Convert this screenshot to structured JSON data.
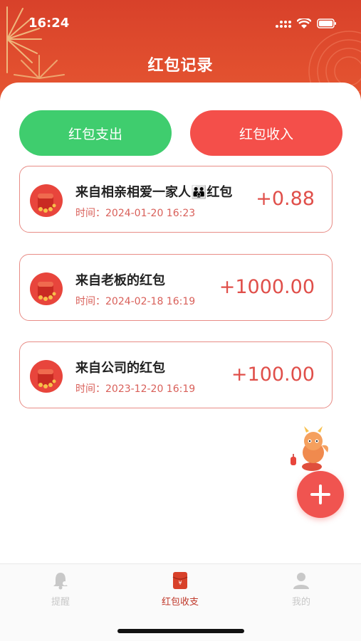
{
  "status": {
    "time": "16:24"
  },
  "header": {
    "title": "红包记录"
  },
  "tabs": {
    "expense_label": "红包支出",
    "income_label": "红包收入"
  },
  "records": [
    {
      "title": "来自相亲相爱一家人👪红包",
      "time": "时间：2024-01-20 16:23",
      "amount": "+0.88"
    },
    {
      "title": "来自老板的红包",
      "time": "时间：2024-02-18 16:19",
      "amount": "+1000.00"
    },
    {
      "title": "来自公司的红包",
      "time": "时间：2023-12-20 16:19",
      "amount": "+100.00"
    }
  ],
  "bottom_nav": [
    {
      "label": "提醒",
      "icon": "bell-icon"
    },
    {
      "label": "红包收支",
      "icon": "red-envelope-icon"
    },
    {
      "label": "我的",
      "icon": "user-icon"
    }
  ],
  "colors": {
    "header_red": "#e2502f",
    "expense_green": "#3fcd6e",
    "income_red": "#f44f4a",
    "amount_red": "#e04f4a",
    "nav_active": "#c0392b",
    "nav_inactive": "#c8c8c8"
  }
}
